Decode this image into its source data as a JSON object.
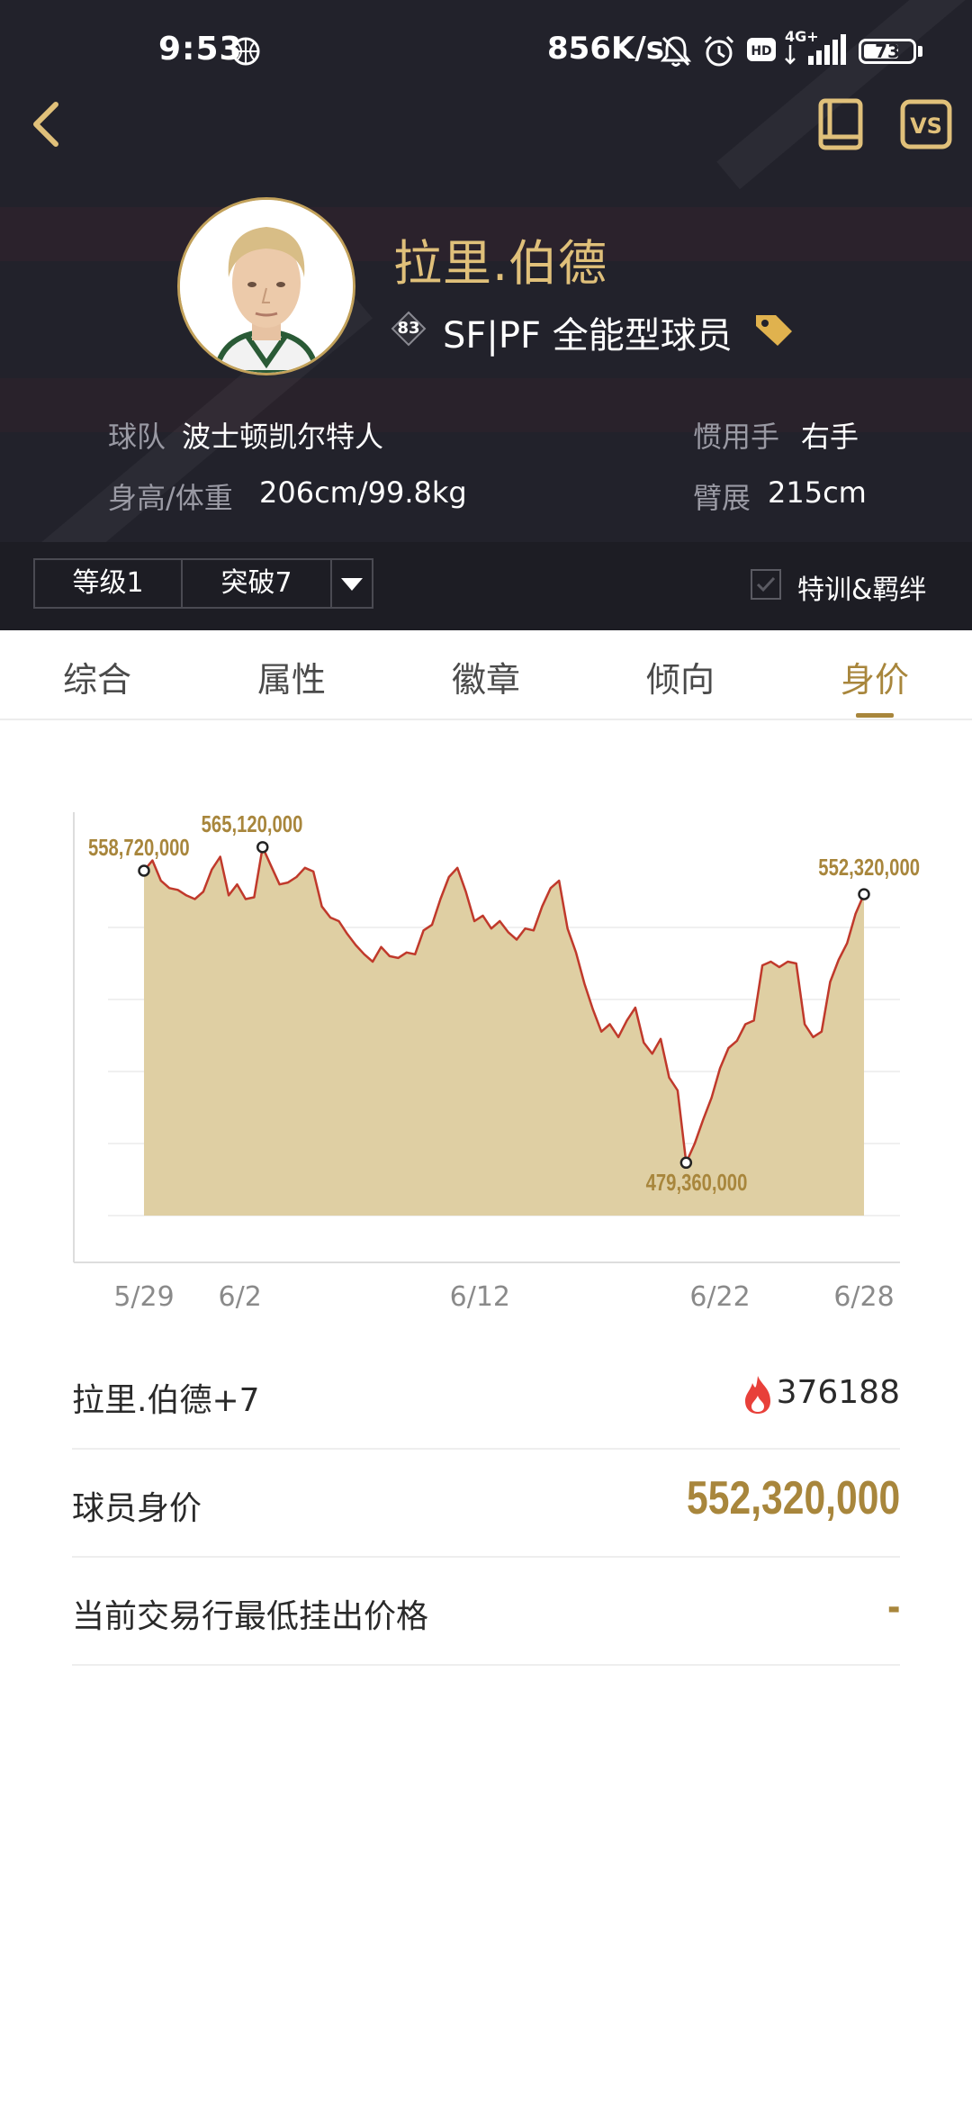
{
  "status_bar": {
    "time": "9:53",
    "net_speed": "856K/s",
    "network": "4G+",
    "battery": "73",
    "battery_level": 0.73
  },
  "header": {
    "player_name": "拉里.伯德",
    "overall": "83",
    "position": "SF|PF 全能型球员",
    "team_label": "球队",
    "team": "波士顿凯尔特人",
    "hand_label": "惯用手",
    "hand": "右手",
    "size_label": "身高/体重",
    "size": "206cm/99.8kg",
    "wingspan_label": "臂展",
    "wingspan": "215cm",
    "level": "等级1",
    "breakthrough": "突破7",
    "training_label": "特训&羁绊",
    "accent_color": "#e0c07a"
  },
  "tabs": {
    "overview": "综合",
    "attributes": "属性",
    "badges": "徽章",
    "tendencies": "倾向",
    "value": "身价",
    "active": "value"
  },
  "chart_data": {
    "type": "area",
    "x_start": "5/29",
    "x_end": "6/28",
    "xtick_labels": [
      "5/29",
      "6/2",
      "6/12",
      "6/22",
      "6/28"
    ],
    "annotations": {
      "start": "558,720,000",
      "max": "565,120,000",
      "min": "479,360,000",
      "end": "552,320,000"
    },
    "ylim": [
      465000000,
      580000000
    ],
    "line_color": "#c0392b",
    "fill_color": "#dfcfa3",
    "values": [
      [
        "5/29",
        558720000
      ],
      [
        "5/29",
        561500000
      ],
      [
        "5/30",
        556000000
      ],
      [
        "5/30",
        554000000
      ],
      [
        "5/31",
        553500000
      ],
      [
        "5/31",
        552000000
      ],
      [
        "6/1",
        551000000
      ],
      [
        "6/1",
        553000000
      ],
      [
        "6/2",
        559000000
      ],
      [
        "6/2",
        562500000
      ],
      [
        "6/2",
        552000000
      ],
      [
        "6/3",
        555000000
      ],
      [
        "6/3",
        551000000
      ],
      [
        "6/4",
        551500000
      ],
      [
        "6/4",
        565120000
      ],
      [
        "6/5",
        560000000
      ],
      [
        "6/5",
        555000000
      ],
      [
        "6/6",
        555500000
      ],
      [
        "6/6",
        557000000
      ],
      [
        "6/6",
        559500000
      ],
      [
        "6/7",
        558500000
      ],
      [
        "6/7",
        549000000
      ],
      [
        "6/8",
        546000000
      ],
      [
        "6/8",
        545000000
      ],
      [
        "6/9",
        541500000
      ],
      [
        "6/9",
        538500000
      ],
      [
        "6/10",
        536000000
      ],
      [
        "6/10",
        534000000
      ],
      [
        "6/11",
        538000000
      ],
      [
        "6/11",
        535500000
      ],
      [
        "6/12",
        535000000
      ],
      [
        "6/12",
        536500000
      ],
      [
        "6/13",
        536000000
      ],
      [
        "6/13",
        542500000
      ],
      [
        "6/14",
        544000000
      ],
      [
        "6/14",
        551000000
      ],
      [
        "6/15",
        557000000
      ],
      [
        "6/15",
        559500000
      ],
      [
        "6/15",
        553000000
      ],
      [
        "6/16",
        545000000
      ],
      [
        "6/16",
        546500000
      ],
      [
        "6/17",
        543000000
      ],
      [
        "6/17",
        545000000
      ],
      [
        "6/18",
        542000000
      ],
      [
        "6/18",
        540000000
      ],
      [
        "6/18",
        543000000
      ],
      [
        "6/19",
        542500000
      ],
      [
        "6/19",
        549000000
      ],
      [
        "6/20",
        554000000
      ],
      [
        "6/20",
        556000000
      ],
      [
        "6/21",
        543000000
      ],
      [
        "6/21",
        536500000
      ],
      [
        "6/22",
        528000000
      ],
      [
        "6/22",
        521000000
      ],
      [
        "6/23",
        515000000
      ],
      [
        "6/23",
        517000000
      ],
      [
        "6/24",
        513500000
      ],
      [
        "6/24",
        518000000
      ],
      [
        "6/24",
        521500000
      ],
      [
        "6/25",
        512000000
      ],
      [
        "6/25",
        509000000
      ],
      [
        "6/26",
        513000000
      ],
      [
        "6/26",
        502500000
      ],
      [
        "6/27",
        499000000
      ],
      [
        "6/27",
        479360000
      ],
      [
        "6/27",
        484500000
      ],
      [
        "6/27",
        491000000
      ],
      [
        "6/28",
        497000000
      ],
      [
        "6/28",
        505000000
      ],
      [
        "6/28",
        510500000
      ],
      [
        "6/28",
        512500000
      ],
      [
        "6/28",
        517000000
      ],
      [
        "6/28",
        518000000
      ],
      [
        "6/28",
        533000000
      ],
      [
        "6/28",
        534000000
      ],
      [
        "6/28",
        532500000
      ],
      [
        "6/28",
        534000000
      ],
      [
        "6/28",
        533500000
      ],
      [
        "6/28",
        517000000
      ],
      [
        "6/28",
        513500000
      ],
      [
        "6/28",
        515000000
      ],
      [
        "6/28",
        528500000
      ],
      [
        "6/28",
        534500000
      ],
      [
        "6/28",
        539000000
      ],
      [
        "6/28",
        547000000
      ],
      [
        "6/28",
        552320000
      ]
    ]
  },
  "details": {
    "card_name": "拉里.伯德+7",
    "heat": "376188",
    "value_label": "球员身价",
    "value": "552,320,000",
    "market_label": "当前交易行最低挂出价格",
    "market_value": "-"
  }
}
